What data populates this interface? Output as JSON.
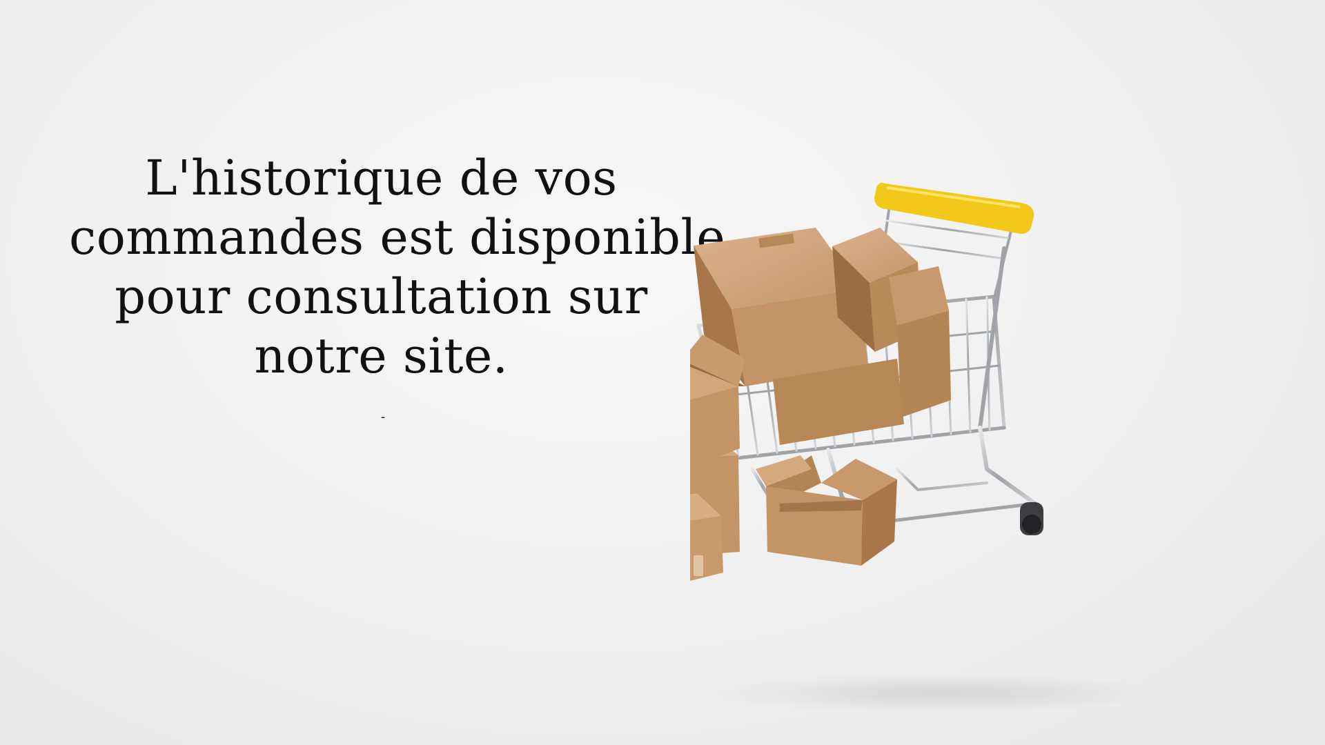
{
  "headline": {
    "lines": [
      "L'historique de vos",
      "commandes est disponible",
      "pour consultation sur",
      "notre site."
    ]
  },
  "separator": "-",
  "illustration": {
    "subject": "shopping-cart-with-cardboard-boxes",
    "colors": {
      "background": "#efefef",
      "cardboard": "#c49366",
      "cardboard_dark": "#a87649",
      "cardboard_light": "#d6aa7f",
      "handle_yellow": "#f2c81a",
      "chrome": "#b9bcc0"
    }
  }
}
